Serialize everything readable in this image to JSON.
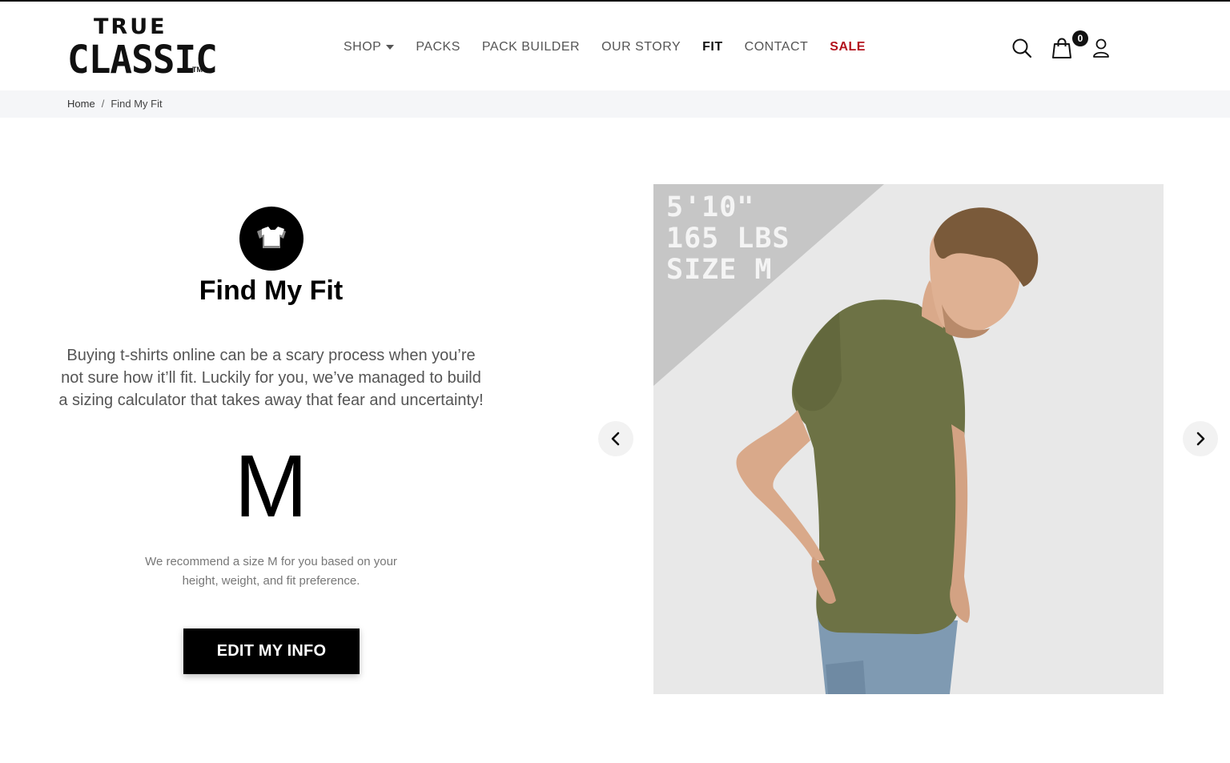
{
  "brand": {
    "line1": "TRUE",
    "line2": "CLASSIC",
    "tm": "TM"
  },
  "nav": {
    "items": [
      {
        "label": "SHOP",
        "has_dropdown": true
      },
      {
        "label": "PACKS"
      },
      {
        "label": "PACK BUILDER"
      },
      {
        "label": "OUR STORY"
      },
      {
        "label": "FIT",
        "active": true
      },
      {
        "label": "CONTACT"
      },
      {
        "label": "SALE",
        "color": "#b3121d"
      }
    ]
  },
  "header_icons": {
    "search": "search-icon",
    "cart": "shopping-bag-icon",
    "account": "user-icon",
    "cart_count": "0"
  },
  "breadcrumb": {
    "home": "Home",
    "separator": "/",
    "current": "Find My Fit"
  },
  "fit": {
    "icon": "tshirt-icon",
    "title": "Find My Fit",
    "intro": "Buying t-shirts online can be a scary process when you’re not sure how it’ll fit. Luckily for you, we’ve managed to build a sizing calculator that takes away that fear and uncertainty!",
    "size": "M",
    "recommendation": "We recommend a size M for you based on your height, weight, and fit preference.",
    "edit_button": "EDIT MY INFO"
  },
  "carousel": {
    "prev_icon": "chevron-left-icon",
    "next_icon": "chevron-right-icon",
    "model_height": "5'10\"",
    "model_weight": "165 LBS",
    "model_size": "SIZE M"
  },
  "colors": {
    "sale": "#b3121d",
    "button_bg": "#000000",
    "breadcrumb_bg": "#f5f6f8",
    "shirt": "#6d7245"
  }
}
